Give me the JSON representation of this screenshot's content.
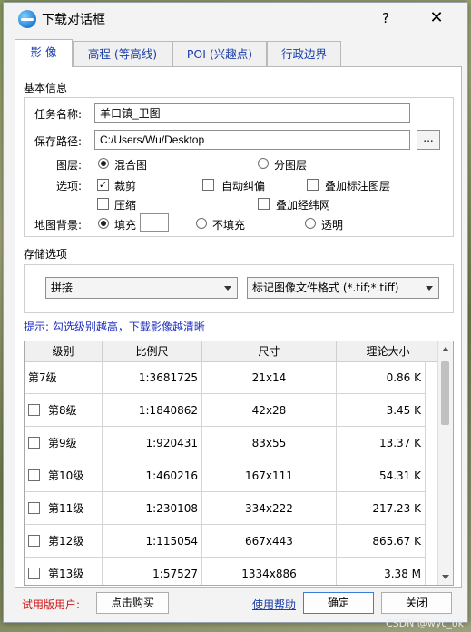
{
  "window": {
    "title": "下载对话框",
    "help_label": "?",
    "close_label": "✕"
  },
  "tabs": [
    {
      "label": "影  像",
      "active": true
    },
    {
      "label": "高程 (等高线)",
      "active": false
    },
    {
      "label": "POI (兴趣点)",
      "active": false
    },
    {
      "label": "行政边界",
      "active": false
    }
  ],
  "basic": {
    "section_title": "基本信息",
    "task_label": "任务名称:",
    "task_value": "羊口镇_卫图",
    "path_label": "保存路径:",
    "path_value": "C:/Users/Wu/Desktop",
    "browse_label": "...",
    "layer_label": "图层:",
    "layer_opt1": "混合图",
    "layer_opt2": "分图层",
    "options_label": "选项:",
    "opt_crop": "裁剪",
    "opt_crop_check": "✓",
    "opt_autocorrect": "自动纠偏",
    "opt_overlay_labels": "叠加标注图层",
    "opt_compress": "压缩",
    "opt_graticule": "叠加经纬网",
    "bg_label": "地图背景:",
    "bg_fill": "填充",
    "bg_nofill": "不填充",
    "bg_transparent": "透明"
  },
  "storage": {
    "section_title": "存储选项",
    "mode_value": "拼接",
    "format_value": "标记图像文件格式 (*.tif;*.tiff)"
  },
  "hint": "提示: 勾选级别越高，下载影像越清晰",
  "table": {
    "headers": [
      "级别",
      "比例尺",
      "尺寸",
      "理论大小"
    ],
    "rows": [
      {
        "level": "第7级",
        "scale": "1:3681725",
        "size": "21x14",
        "est": "0.86 K",
        "checkbox": false
      },
      {
        "level": "第8级",
        "scale": "1:1840862",
        "size": "42x28",
        "est": "3.45 K",
        "checkbox": true
      },
      {
        "level": "第9级",
        "scale": "1:920431",
        "size": "83x55",
        "est": "13.37 K",
        "checkbox": true
      },
      {
        "level": "第10级",
        "scale": "1:460216",
        "size": "167x111",
        "est": "54.31 K",
        "checkbox": true
      },
      {
        "level": "第11级",
        "scale": "1:230108",
        "size": "334x222",
        "est": "217.23 K",
        "checkbox": true
      },
      {
        "level": "第12级",
        "scale": "1:115054",
        "size": "667x443",
        "est": "865.67 K",
        "checkbox": true
      },
      {
        "level": "第13级",
        "scale": "1:57527",
        "size": "1334x886",
        "est": "3.38 M",
        "checkbox": true
      }
    ]
  },
  "footer": {
    "trial_label": "试用版用户:",
    "buy_label": "点击购买",
    "help_link": "使用帮助",
    "ok_label": "确定",
    "close_label": "关闭"
  },
  "watermark": "CSDN @wyc_ok"
}
